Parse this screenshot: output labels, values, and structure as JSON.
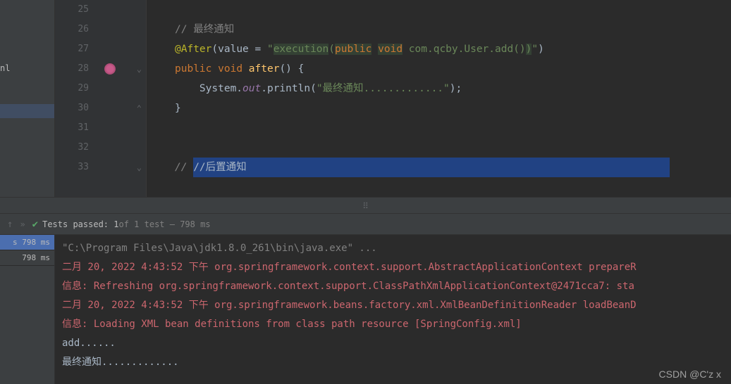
{
  "editor": {
    "lineStart": 25,
    "lines": [
      {
        "n": 25,
        "tokens": []
      },
      {
        "n": 26,
        "tokens": [
          {
            "t": "// 最终通知",
            "c": "comment"
          }
        ]
      },
      {
        "n": 27,
        "tokens": [
          {
            "t": "@After",
            "c": "anno"
          },
          {
            "t": "(",
            "c": "white"
          },
          {
            "t": "value = ",
            "c": "white"
          },
          {
            "t": "\"",
            "c": "str"
          },
          {
            "t": "execution",
            "c": "str highlight-bg"
          },
          {
            "t": "(",
            "c": "str"
          },
          {
            "t": "public",
            "c": "kw highlight-bg"
          },
          {
            "t": " ",
            "c": "str"
          },
          {
            "t": "void",
            "c": "kw highlight-bg"
          },
          {
            "t": " com.qcby.User.add()",
            "c": "str"
          },
          {
            "t": ")",
            "c": "str highlight-bg"
          },
          {
            "t": "\"",
            "c": "str"
          },
          {
            "t": ")",
            "c": "white"
          }
        ]
      },
      {
        "n": 28,
        "tokens": [
          {
            "t": "public",
            "c": "kw"
          },
          {
            "t": " ",
            "c": "white"
          },
          {
            "t": "void",
            "c": "kw"
          },
          {
            "t": " ",
            "c": "white"
          },
          {
            "t": "after",
            "c": "method"
          },
          {
            "t": "() {",
            "c": "white"
          }
        ],
        "bean": true,
        "fold": "⌄"
      },
      {
        "n": 29,
        "tokens": [
          {
            "t": "    System.",
            "c": "white"
          },
          {
            "t": "out",
            "c": "field"
          },
          {
            "t": ".println(",
            "c": "white"
          },
          {
            "t": "\"最终通知.............\"",
            "c": "str"
          },
          {
            "t": ");",
            "c": "white"
          }
        ]
      },
      {
        "n": 30,
        "tokens": [
          {
            "t": "}",
            "c": "white"
          }
        ],
        "fold": "⌃"
      },
      {
        "n": 31,
        "tokens": []
      },
      {
        "n": 32,
        "tokens": []
      },
      {
        "n": 33,
        "tokens": [
          {
            "t": "// ",
            "c": "comment cursor",
            "bg": false
          },
          {
            "t": "//后置通知",
            "c": "white",
            "bg": true
          }
        ],
        "selected": true,
        "fold": "⌄"
      }
    ],
    "leftTag": "nl"
  },
  "testBar": {
    "label": "Tests passed:",
    "passed": "1",
    "of": " of 1 test – 798 ms"
  },
  "leftTabs": [
    {
      "label": "s 798 ms",
      "active": true
    },
    {
      "label": "798 ms",
      "active": false
    }
  ],
  "console": [
    {
      "text": "\"C:\\Program Files\\Java\\jdk1.8.0_261\\bin\\java.exe\" ...",
      "c": "c-cmd"
    },
    {
      "text": "二月 20, 2022 4:43:52 下午 org.springframework.context.support.AbstractApplicationContext prepareR",
      "c": "c-log"
    },
    {
      "text": "信息: Refreshing org.springframework.context.support.ClassPathXmlApplicationContext@2471cca7: sta",
      "c": "c-log"
    },
    {
      "text": "二月 20, 2022 4:43:52 下午 org.springframework.beans.factory.xml.XmlBeanDefinitionReader loadBeanD",
      "c": "c-log"
    },
    {
      "text": "信息: Loading XML bean definitions from class path resource [SpringConfig.xml]",
      "c": "c-log"
    },
    {
      "text": "add......",
      "c": "c-out"
    },
    {
      "text": "最终通知.............",
      "c": "c-out"
    }
  ],
  "watermark": "CSDN @C'z  x"
}
